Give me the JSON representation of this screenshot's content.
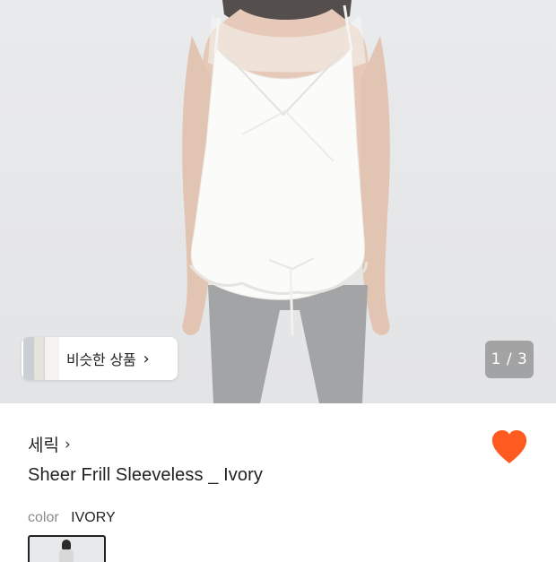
{
  "hero": {
    "image_alt": "Model wearing white sheer frill sleeveless top with grey leggings",
    "similar_button": {
      "label": "비슷한 상품",
      "chevron_icon": "chevron-right-icon"
    },
    "counter": "1 / 3"
  },
  "product": {
    "brand": "세릭",
    "brand_chevron_icon": "chevron-right-icon",
    "title": "Sheer Frill Sleeveless _ Ivory",
    "like_icon": "heart-icon",
    "like_color": "#ff5a1f",
    "option_label": "color",
    "option_value": "IVORY"
  }
}
